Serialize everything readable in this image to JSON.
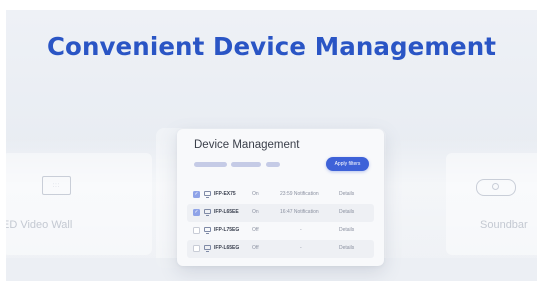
{
  "headline": "Convenient Device Management",
  "background_devices": {
    "left_label": "ED Video Wall",
    "left_icon": "video-wall-icon",
    "right_label": "Soundbar",
    "right_icon": "soundbar-icon"
  },
  "panel": {
    "title": "Device Management",
    "apply_button": "Apply filters",
    "devices": [
      {
        "name": "IFP-EX75",
        "status": "On",
        "notification": "23:59 Notification",
        "details": "Details",
        "checked": true
      },
      {
        "name": "IFP-L65EE",
        "status": "On",
        "notification": "16:47 Notification",
        "details": "Details",
        "checked": true
      },
      {
        "name": "IFP-L75EG",
        "status": "Off",
        "notification": "-",
        "details": "Details",
        "checked": false
      },
      {
        "name": "IFP-L65EG",
        "status": "Off",
        "notification": "-",
        "details": "Details",
        "checked": false
      }
    ]
  },
  "colors": {
    "headline": "#2a55c5",
    "accent": "#3e62d8",
    "checkbox_checked": "#8fa3e8"
  }
}
